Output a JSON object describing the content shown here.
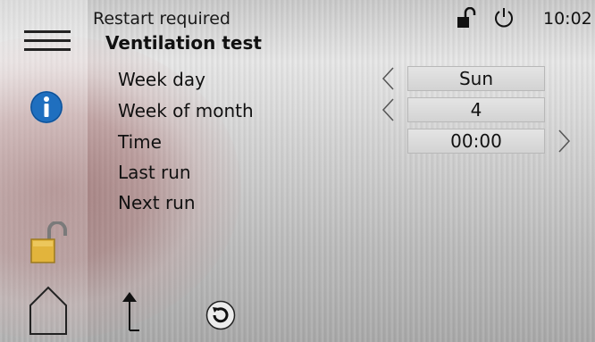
{
  "status": {
    "message": "Restart required",
    "time": "10:02"
  },
  "screen": {
    "title": "Ventilation test"
  },
  "rows": [
    {
      "label": "Week day",
      "value": "Sun"
    },
    {
      "label": "Week of month",
      "value": "4"
    },
    {
      "label": "Time",
      "value": "00:00"
    },
    {
      "label": "Last run"
    },
    {
      "label": "Next run"
    }
  ],
  "icons": {
    "menu": "hamburger-menu-icon",
    "info": "info-icon",
    "lock_sidebar": "unlocked-padlock-icon",
    "home": "home-icon",
    "lock_status": "unlocked-padlock-icon",
    "power": "power-icon",
    "back": "up-arrow-icon",
    "restore": "factory-restore-icon",
    "prev": "chevron-left-icon",
    "next": "chevron-right-icon"
  },
  "colors": {
    "info_blue": "#1f6fbf",
    "lock_gold": "#e2b43c"
  }
}
